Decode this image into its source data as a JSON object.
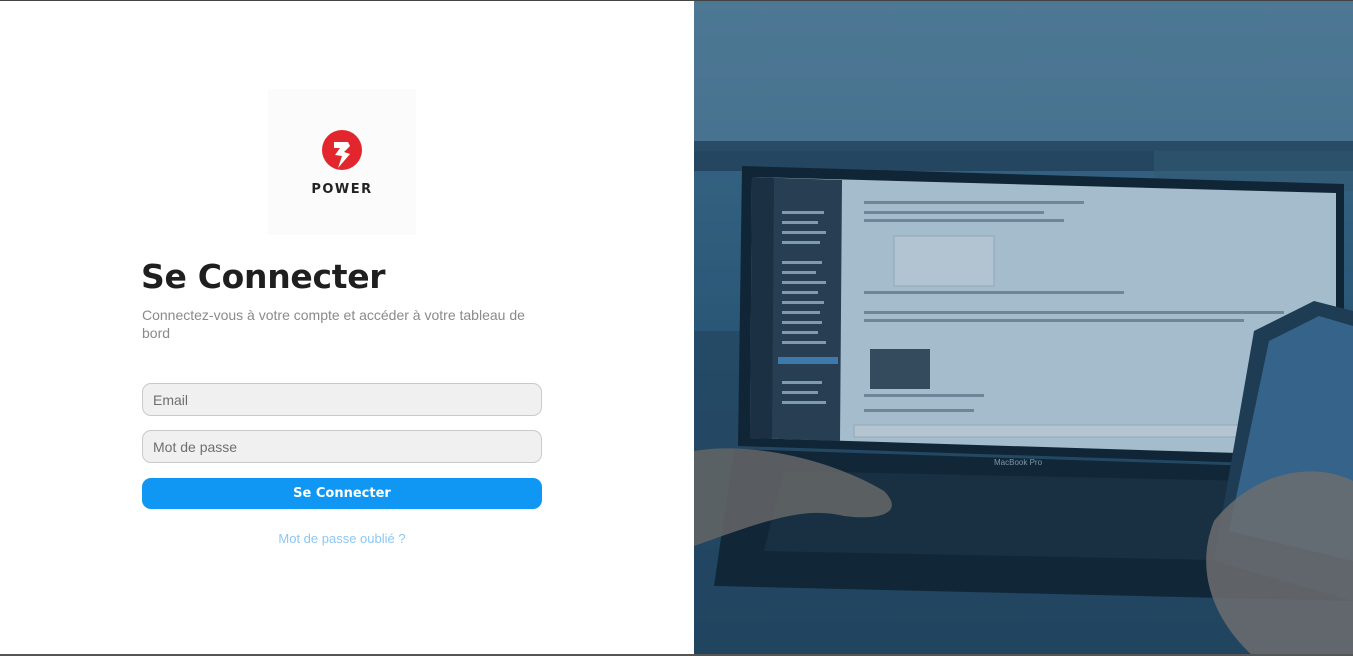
{
  "brand": {
    "logo_text": "POWER",
    "logo_color": "#e3262d"
  },
  "login": {
    "title": "Se Connecter",
    "subtitle": "Connectez-vous à votre compte et accéder à votre tableau de bord",
    "email_placeholder": "Email",
    "password_placeholder": "Mot de passe",
    "submit_label": "Se Connecter",
    "forgot_label": "Mot de passe oublié ?"
  },
  "hero": {
    "laptop_label": "MacBook Pro"
  },
  "colors": {
    "accent": "#1096f3",
    "link": "#8cc7f3",
    "overlay": "#2a4f6a"
  }
}
